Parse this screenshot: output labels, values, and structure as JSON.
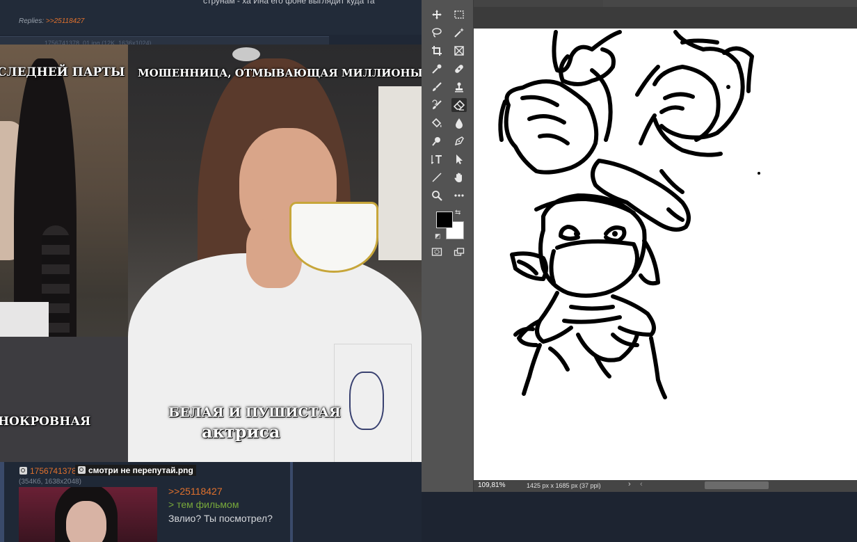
{
  "board": {
    "top_post_text": "струнам - ха Ина его фоне выглядит куда та",
    "replies_label": "Replies:",
    "replies_link": ">>25118427",
    "separator_text": "1756741378_01.jpg (12K, 1636x1024)",
    "meme": {
      "caption_left_top": "СЛЕДНЕЙ ПАРТЫ",
      "caption_right_top": "МОШЕННИЦА, ОТМЫВАЮЩАЯ МИЛЛИОНЫ ДОЛЛ",
      "caption_left_bottom": "НОКРОВНАЯ",
      "caption_right_bottom_line1": "БЕЛАЯ И ПУШИСТАЯ",
      "caption_right_bottom_line2": "актриса"
    },
    "reply": {
      "file_name": "1756741378",
      "file_tooltip": "смотри не перепутай.png",
      "file_meta": "(354Кб, 1638x2048)",
      "link": ">>25118427",
      "quote": "> тем фильмом",
      "text": "Звлио? Ты посмотрел?"
    }
  },
  "photoshop": {
    "zoom": "109,81%",
    "document_info": "1425 px x 1685 px (37 ppi)",
    "status_arrow": "›",
    "scroll_left_arrow": "‹",
    "colors": {
      "foreground": "#000000",
      "background": "#ffffff"
    },
    "tools": [
      {
        "name": "move-tool-icon"
      },
      {
        "name": "marquee-tool-icon"
      },
      {
        "name": "lasso-tool-icon"
      },
      {
        "name": "magic-wand-tool-icon"
      },
      {
        "name": "crop-tool-icon"
      },
      {
        "name": "frame-tool-icon"
      },
      {
        "name": "eyedropper-tool-icon"
      },
      {
        "name": "healing-brush-tool-icon"
      },
      {
        "name": "brush-tool-icon"
      },
      {
        "name": "clone-stamp-tool-icon"
      },
      {
        "name": "history-brush-tool-icon"
      },
      {
        "name": "eraser-tool-icon"
      },
      {
        "name": "paint-bucket-tool-icon"
      },
      {
        "name": "blur-tool-icon"
      },
      {
        "name": "dodge-tool-icon"
      },
      {
        "name": "pen-tool-icon"
      },
      {
        "name": "type-tool-icon"
      },
      {
        "name": "path-selection-tool-icon"
      },
      {
        "name": "line-tool-icon"
      },
      {
        "name": "hand-tool-icon"
      },
      {
        "name": "zoom-tool-icon"
      },
      {
        "name": "more-tools-icon"
      }
    ]
  }
}
